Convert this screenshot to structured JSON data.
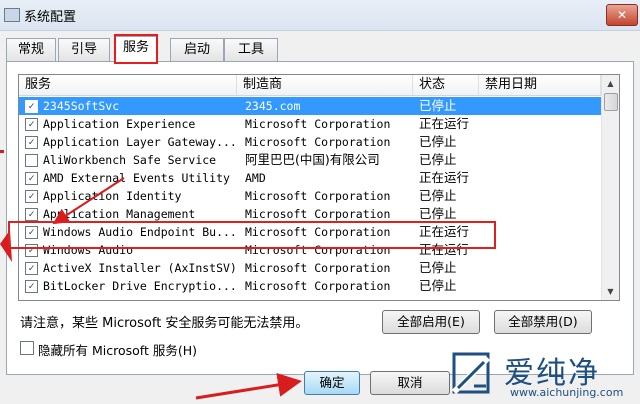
{
  "window": {
    "title": "系统配置",
    "close_glyph": "✕"
  },
  "tabs": [
    {
      "label": "常规"
    },
    {
      "label": "引导"
    },
    {
      "label": "服务"
    },
    {
      "label": "启动"
    },
    {
      "label": "工具"
    }
  ],
  "active_tab": "服务",
  "columns": {
    "service": "服务",
    "manufacturer": "制造商",
    "status": "状态",
    "disabled_date": "禁用日期"
  },
  "rows": [
    {
      "checked": true,
      "name": "2345SoftSvc",
      "manufacturer": "2345.com",
      "status": "已停止"
    },
    {
      "checked": true,
      "name": "Application Experience",
      "manufacturer": "Microsoft Corporation",
      "status": "正在运行"
    },
    {
      "checked": true,
      "name": "Application Layer Gateway...",
      "manufacturer": "Microsoft Corporation",
      "status": "已停止"
    },
    {
      "checked": false,
      "name": "AliWorkbench Safe Service",
      "manufacturer": "阿里巴巴(中国)有限公司",
      "status": "已停止"
    },
    {
      "checked": true,
      "name": "AMD External Events Utility",
      "manufacturer": "AMD",
      "status": "正在运行"
    },
    {
      "checked": true,
      "name": "Application Identity",
      "manufacturer": "Microsoft Corporation",
      "status": "已停止"
    },
    {
      "checked": true,
      "name": "Application Management",
      "manufacturer": "Microsoft Corporation",
      "status": "已停止"
    },
    {
      "checked": true,
      "name": "Windows Audio Endpoint Bu...",
      "manufacturer": "Microsoft Corporation",
      "status": "正在运行"
    },
    {
      "checked": true,
      "name": "Windows Audio",
      "manufacturer": "Microsoft Corporation",
      "status": "正在运行"
    },
    {
      "checked": true,
      "name": "ActiveX Installer (AxInstSV)",
      "manufacturer": "Microsoft Corporation",
      "status": "已停止"
    },
    {
      "checked": true,
      "name": "BitLocker Drive Encryptio...",
      "manufacturer": "Microsoft Corporation",
      "status": "已停止"
    }
  ],
  "selected_row": 0,
  "checkmark": "✓",
  "note": "请注意，某些 Microsoft 安全服务可能无法禁用。",
  "buttons": {
    "enable_all": "全部启用(E)",
    "disable_all": "全部禁用(D)",
    "ok": "确定",
    "cancel": "取消"
  },
  "hide_ms_services": {
    "checked": false,
    "label": "隐藏所有 Microsoft 服务(H)"
  },
  "watermark": {
    "name": "爱纯净",
    "url": "www.aichunjing.com"
  },
  "colors": {
    "selection": "#3399ff",
    "annotation_red": "#e02020",
    "watermark_blue": "#1d4f80"
  }
}
